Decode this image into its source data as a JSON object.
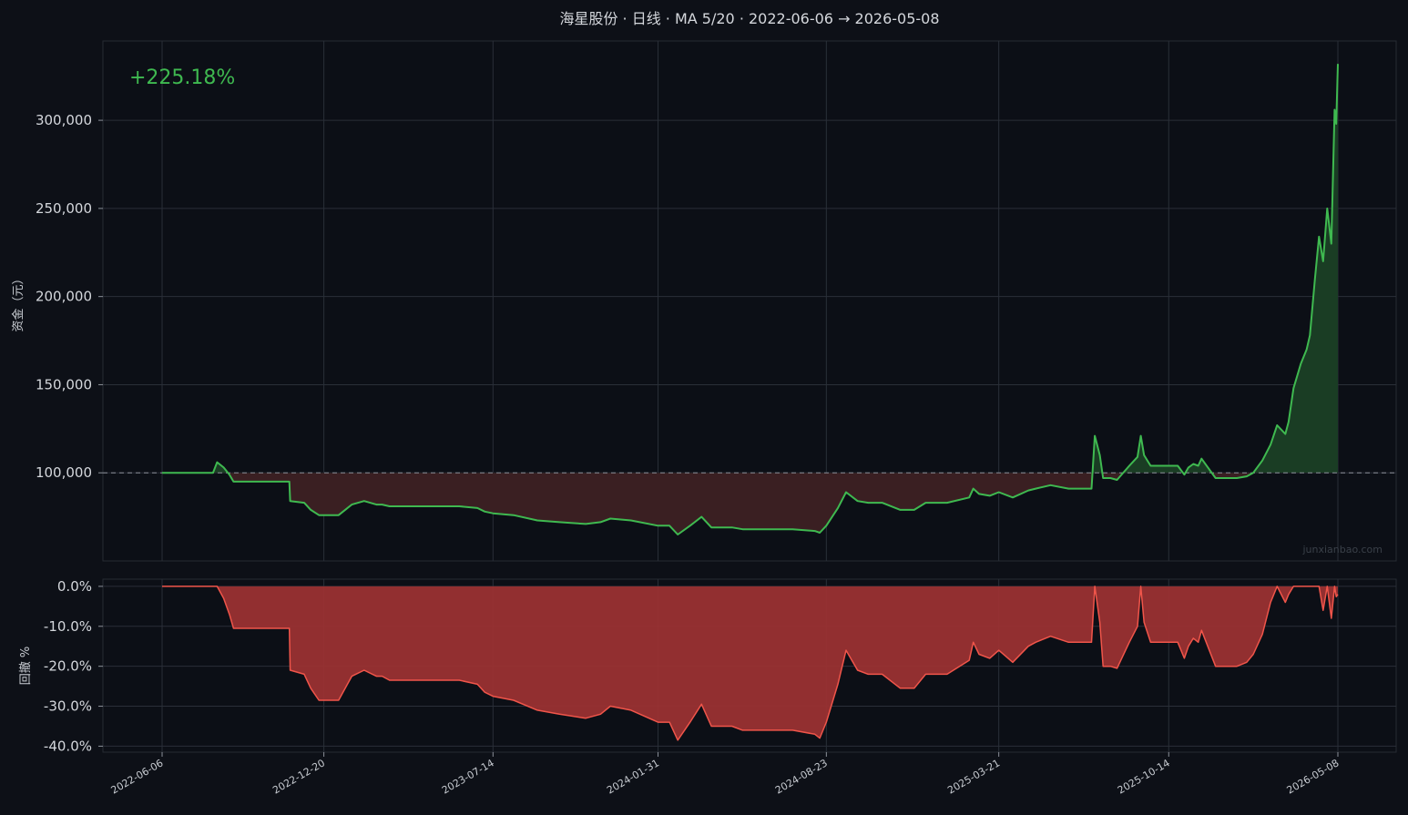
{
  "title": "海星股份 · 日线 · MA 5/20 · 2022-06-06 → 2026-05-08",
  "return_label": "+225.18%",
  "watermark": "junxianbao.com",
  "colors": {
    "background": "#0d1017",
    "plot_bg": "#0c0f16",
    "grid": "#2a2f38",
    "equity_line": "#3fb950",
    "equity_fill_up": "#1a3d24",
    "equity_fill_down": "#3a1f22",
    "drawdown_line": "#f0554a",
    "drawdown_fill": "#9a3232",
    "baseline": "#8b9099",
    "return_text": "#3fb950"
  },
  "chart_data": [
    {
      "type": "area",
      "name": "equity",
      "ylabel": "资金（元）",
      "ylim": [
        50000,
        345000
      ],
      "yticks": [
        100000,
        150000,
        200000,
        250000,
        300000
      ],
      "ytick_labels": [
        "100,000",
        "150,000",
        "200,000",
        "250,000",
        "300,000"
      ],
      "baseline": 100000,
      "grid": true,
      "x": [
        "2022-06-06",
        "2022-08-07",
        "2022-08-12",
        "2022-08-20",
        "2022-08-27",
        "2022-09-01",
        "2022-11-08",
        "2022-11-09",
        "2022-11-26",
        "2022-12-04",
        "2022-12-14",
        "2023-01-07",
        "2023-01-23",
        "2023-02-07",
        "2023-02-22",
        "2023-03-01",
        "2023-03-10",
        "2023-04-07",
        "2023-05-05",
        "2023-06-03",
        "2023-06-25",
        "2023-07-04",
        "2023-07-14",
        "2023-08-08",
        "2023-09-06",
        "2023-10-03",
        "2023-11-04",
        "2023-11-22",
        "2023-12-04",
        "2023-12-29",
        "2024-01-31",
        "2024-02-14",
        "2024-02-24",
        "2024-03-10",
        "2024-03-24",
        "2024-04-05",
        "2024-04-30",
        "2024-05-13",
        "2024-06-09",
        "2024-07-13",
        "2024-08-09",
        "2024-08-15",
        "2024-08-23",
        "2024-09-06",
        "2024-09-16",
        "2024-09-30",
        "2024-10-13",
        "2024-10-30",
        "2024-11-21",
        "2024-12-08",
        "2024-12-22",
        "2025-01-17",
        "2025-02-13",
        "2025-02-18",
        "2025-02-25",
        "2025-03-10",
        "2025-03-21",
        "2025-04-07",
        "2025-04-26",
        "2025-05-05",
        "2025-05-23",
        "2025-06-14",
        "2025-07-12",
        "2025-07-16",
        "2025-07-22",
        "2025-07-26",
        "2025-08-04",
        "2025-08-12",
        "2025-08-27",
        "2025-09-06",
        "2025-09-10",
        "2025-09-14",
        "2025-09-22",
        "2025-10-14",
        "2025-10-25",
        "2025-11-02",
        "2025-11-07",
        "2025-11-13",
        "2025-11-19",
        "2025-11-23",
        "2025-12-10",
        "2025-12-20",
        "2026-01-05",
        "2026-01-17",
        "2026-01-25",
        "2026-02-05",
        "2026-02-15",
        "2026-02-23",
        "2026-03-05",
        "2026-03-09",
        "2026-03-15",
        "2026-03-24",
        "2026-03-31",
        "2026-04-04",
        "2026-04-10",
        "2026-04-15",
        "2026-04-20",
        "2026-04-25",
        "2026-04-30",
        "2026-05-04",
        "2026-05-06",
        "2026-05-08"
      ],
      "values": [
        100000,
        100000,
        106000,
        103000,
        99000,
        95000,
        95000,
        84000,
        83000,
        79000,
        76000,
        76000,
        82000,
        84000,
        82000,
        82000,
        81000,
        81000,
        81000,
        81000,
        80000,
        78000,
        77000,
        76000,
        73000,
        72000,
        71000,
        72000,
        74000,
        73000,
        70000,
        70000,
        65000,
        70000,
        75000,
        69000,
        69000,
        68000,
        68000,
        68000,
        67000,
        66000,
        70000,
        80000,
        89000,
        84000,
        83000,
        83000,
        79000,
        79000,
        83000,
        83000,
        86000,
        91000,
        88000,
        87000,
        89000,
        86000,
        90000,
        91000,
        93000,
        91000,
        91000,
        121000,
        110000,
        97000,
        97000,
        96000,
        104000,
        109000,
        121000,
        110000,
        104000,
        104000,
        104000,
        99000,
        103000,
        105000,
        104000,
        108000,
        97000,
        97000,
        97000,
        98000,
        100000,
        107000,
        116000,
        127000,
        122000,
        129000,
        148000,
        162000,
        170000,
        178000,
        210000,
        234000,
        220000,
        250000,
        230000,
        306000,
        298000,
        332000
      ],
      "final_value": 325180
    },
    {
      "type": "area",
      "name": "drawdown",
      "ylabel": "回撤 %",
      "ylim": [
        -41.5,
        1.8
      ],
      "yticks": [
        0,
        -10,
        -20,
        -30,
        -40
      ],
      "ytick_labels": [
        "0.0%",
        "-10.0%",
        "-20.0%",
        "-30.0%",
        "-40.0%"
      ],
      "grid": true,
      "x": [
        "2022-06-06",
        "2022-08-07",
        "2022-08-12",
        "2022-08-20",
        "2022-08-27",
        "2022-09-01",
        "2022-11-08",
        "2022-11-09",
        "2022-11-26",
        "2022-12-04",
        "2022-12-14",
        "2023-01-07",
        "2023-01-23",
        "2023-02-07",
        "2023-02-22",
        "2023-03-01",
        "2023-03-10",
        "2023-04-07",
        "2023-05-05",
        "2023-06-03",
        "2023-06-25",
        "2023-07-04",
        "2023-07-14",
        "2023-08-08",
        "2023-09-06",
        "2023-10-03",
        "2023-11-04",
        "2023-11-22",
        "2023-12-04",
        "2023-12-29",
        "2024-01-31",
        "2024-02-14",
        "2024-02-24",
        "2024-03-10",
        "2024-03-24",
        "2024-04-05",
        "2024-04-30",
        "2024-05-13",
        "2024-06-09",
        "2024-07-13",
        "2024-08-09",
        "2024-08-15",
        "2024-08-23",
        "2024-09-06",
        "2024-09-16",
        "2024-09-30",
        "2024-10-13",
        "2024-10-30",
        "2024-11-21",
        "2024-12-08",
        "2024-12-22",
        "2025-01-17",
        "2025-02-13",
        "2025-02-18",
        "2025-02-25",
        "2025-03-10",
        "2025-03-21",
        "2025-04-07",
        "2025-04-26",
        "2025-05-05",
        "2025-05-23",
        "2025-06-14",
        "2025-07-12",
        "2025-07-16",
        "2025-07-22",
        "2025-07-26",
        "2025-08-04",
        "2025-08-12",
        "2025-08-27",
        "2025-09-06",
        "2025-09-10",
        "2025-09-14",
        "2025-09-22",
        "2025-10-14",
        "2025-10-25",
        "2025-11-02",
        "2025-11-07",
        "2025-11-13",
        "2025-11-19",
        "2025-11-23",
        "2025-12-10",
        "2025-12-20",
        "2026-01-05",
        "2026-01-17",
        "2026-01-25",
        "2026-02-05",
        "2026-02-15",
        "2026-02-23",
        "2026-03-05",
        "2026-03-09",
        "2026-03-15",
        "2026-03-24",
        "2026-03-31",
        "2026-04-04",
        "2026-04-10",
        "2026-04-15",
        "2026-04-20",
        "2026-04-25",
        "2026-04-30",
        "2026-05-04",
        "2026-05-06",
        "2026-05-08"
      ],
      "values": [
        0,
        0,
        0,
        -3,
        -7,
        -10.5,
        -10.5,
        -21,
        -22,
        -25.5,
        -28.5,
        -28.5,
        -22.5,
        -21,
        -22.5,
        -22.5,
        -23.5,
        -23.5,
        -23.5,
        -23.5,
        -24.5,
        -26.5,
        -27.5,
        -28.5,
        -31,
        -32,
        -33,
        -32,
        -30,
        -31,
        -34,
        -34,
        -38.5,
        -34,
        -29.5,
        -35,
        -35,
        -36,
        -36,
        -36,
        -37,
        -38,
        -34,
        -24.5,
        -16,
        -21,
        -22,
        -22,
        -25.5,
        -25.5,
        -22,
        -22,
        -18.5,
        -14,
        -17,
        -18,
        -16,
        -19,
        -15,
        -14,
        -12.5,
        -14,
        -14,
        0,
        -9,
        -20,
        -20,
        -20.5,
        -14,
        -10,
        0,
        -9,
        -14,
        -14,
        -14,
        -18,
        -15,
        -13,
        -14,
        -11,
        -20,
        -20,
        -20,
        -19,
        -17,
        -12,
        -4,
        0,
        -4,
        -2,
        0,
        0,
        0,
        0,
        0,
        0,
        -6,
        0,
        -8,
        0,
        -2.6,
        -2
      ]
    }
  ],
  "x_tick_labels": [
    "2022-06-06",
    "2022-12-20",
    "2023-07-14",
    "2024-01-31",
    "2024-08-23",
    "2025-03-21",
    "2025-10-14",
    "2026-05-08"
  ]
}
